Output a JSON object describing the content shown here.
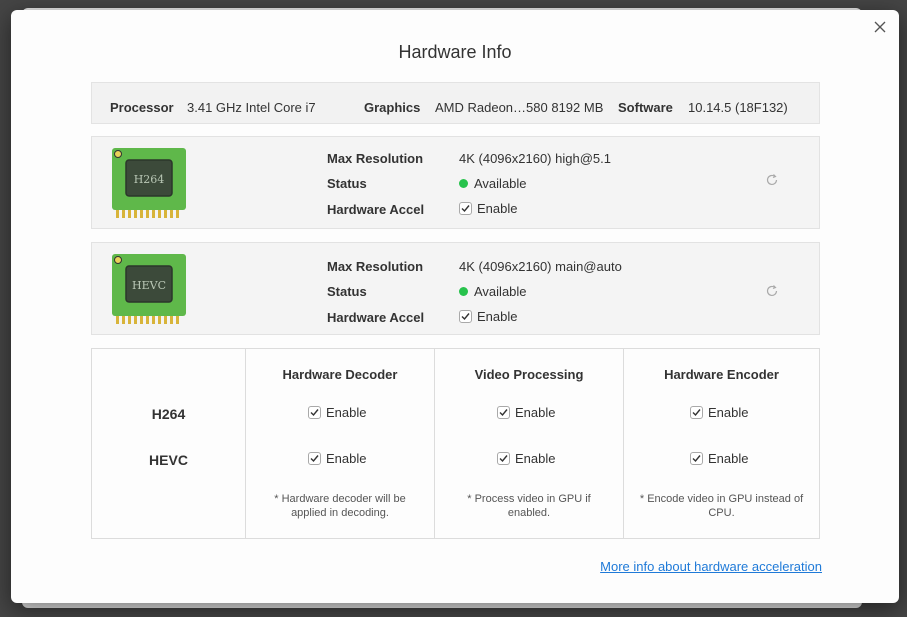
{
  "dialog": {
    "title": "Hardware Info",
    "more_link": "More info about hardware acceleration"
  },
  "system": {
    "processor_label": "Processor",
    "processor_value": "3.41 GHz Intel Core i7",
    "graphics_label": "Graphics",
    "graphics_value": "AMD Radeon…580 8192 MB",
    "software_label": "Software",
    "software_value": "10.14.5 (18F132)"
  },
  "codecs": [
    {
      "chip_label": "H264",
      "max_res_label": "Max Resolution",
      "max_res_value": "4K (4096x2160) high@5.1",
      "status_label": "Status",
      "status_value": "Available",
      "accel_label": "Hardware Accel",
      "accel_checkbox": "Enable",
      "accel_checked": true
    },
    {
      "chip_label": "HEVC",
      "max_res_label": "Max Resolution",
      "max_res_value": "4K (4096x2160) main@auto",
      "status_label": "Status",
      "status_value": "Available",
      "accel_label": "Hardware Accel",
      "accel_checkbox": "Enable",
      "accel_checked": true
    }
  ],
  "matrix": {
    "columns": [
      "Hardware Decoder",
      "Video Processing",
      "Hardware Encoder"
    ],
    "rows": [
      "H264",
      "HEVC"
    ],
    "checkbox_label": "Enable",
    "checked": [
      [
        true,
        true,
        true
      ],
      [
        true,
        true,
        true
      ]
    ],
    "notes": [
      "* Hardware decoder will be applied in decoding.",
      "* Process video in GPU if enabled.",
      "* Encode video in GPU instead of CPU."
    ]
  },
  "colors": {
    "status_available": "#27c24c",
    "link": "#1f7ad8",
    "chip_board": "#5fb84a",
    "chip_core": "#3c4a3a"
  },
  "icons": {
    "close": "close-icon",
    "refresh": "refresh-icon",
    "checkmark": "checkmark-icon",
    "chip": "chip-icon"
  }
}
